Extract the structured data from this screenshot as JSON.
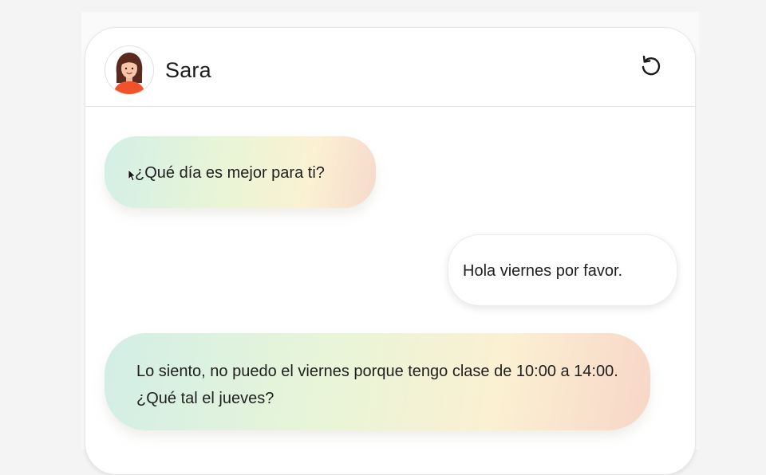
{
  "header": {
    "contact_name": "Sara",
    "avatar_icon": "woman-avatar-icon",
    "reset_icon": "restart-icon"
  },
  "messages": [
    {
      "sender": "contact",
      "text": "¿Qué día es mejor para ti?"
    },
    {
      "sender": "user",
      "text": "Hola viernes por favor."
    },
    {
      "sender": "contact",
      "text": "Lo siento, no puedo el viernes porque tengo clase de 10:00 a 14:00. ¿Qué tal el jueves?"
    }
  ],
  "colors": {
    "bubble_gradient_start": "#d3efe7",
    "bubble_gradient_mid": "#e9f5d6",
    "bubble_gradient_warm": "#fbf1d3",
    "bubble_gradient_end": "#f6d9cc",
    "avatar_shirt": "#f0532a",
    "avatar_hair": "#5a2a1e"
  }
}
